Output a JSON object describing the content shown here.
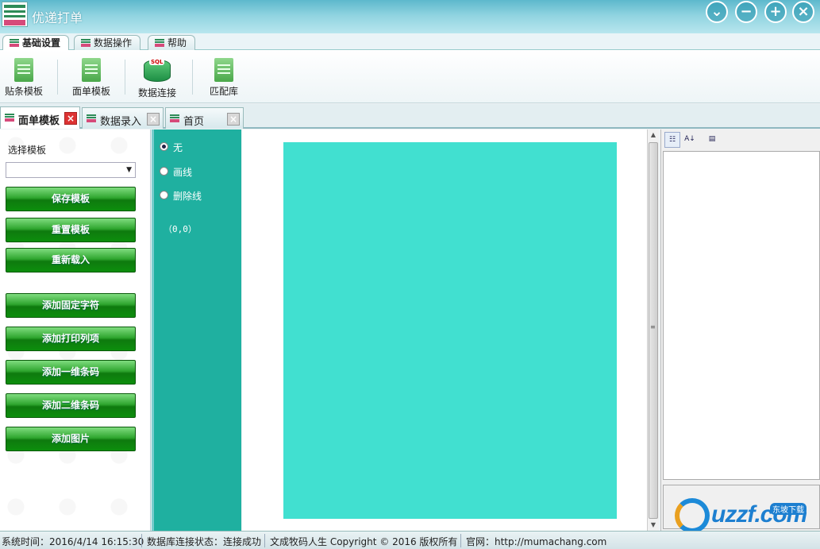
{
  "app": {
    "title": "优递打单",
    "window_controls": [
      "chevron-down-icon",
      "minimize-icon",
      "plus-icon",
      "close-icon"
    ]
  },
  "ribbon_tabs": [
    {
      "label": "基础设置",
      "active": true
    },
    {
      "label": "数据操作",
      "active": false
    },
    {
      "label": "帮助",
      "active": false
    }
  ],
  "toolbar": {
    "buttons": [
      {
        "label": "贴条模板",
        "icon": "document-icon"
      },
      {
        "label": "面单模板",
        "icon": "document-icon"
      },
      {
        "label": "数据连接",
        "icon": "sql-database-icon",
        "icon_text": "SQL"
      },
      {
        "label": "匹配库",
        "icon": "document-icon"
      }
    ]
  },
  "doc_tabs": [
    {
      "label": "面单模板",
      "active": true
    },
    {
      "label": "数据录入",
      "active": false
    },
    {
      "label": "首页",
      "active": false
    }
  ],
  "left_panel": {
    "select_label": "选择模板",
    "select_value": "",
    "buttons": [
      "保存模板",
      "重置模板",
      "重新载入",
      "添加固定字符",
      "添加打印列项",
      "添加一维条码",
      "添加二维条码",
      "添加图片"
    ]
  },
  "line_options": {
    "items": [
      {
        "label": "无",
        "checked": true
      },
      {
        "label": "画线",
        "checked": false
      },
      {
        "label": "删除线",
        "checked": false
      }
    ],
    "coords": "（0,0）"
  },
  "canvas": {
    "sheet_color": "#41e0d0"
  },
  "property_grid": {
    "tools": [
      "categorized-icon",
      "sort-az-icon",
      "property-pages-icon"
    ]
  },
  "watermark": {
    "text": "uzzf.com",
    "badge": "东坡下载"
  },
  "status": {
    "time": "系统时间：2016/4/14 16:15:30",
    "db": "数据库连接状态：连接成功",
    "copyright": "文成牧码人生 Copyright © 2016 版权所有",
    "site": "官网：http://mumachang.com"
  },
  "colors": {
    "accent_green": "#1a8f1a",
    "strip_teal": "#1fb0a0",
    "close_red": "#d33333"
  }
}
